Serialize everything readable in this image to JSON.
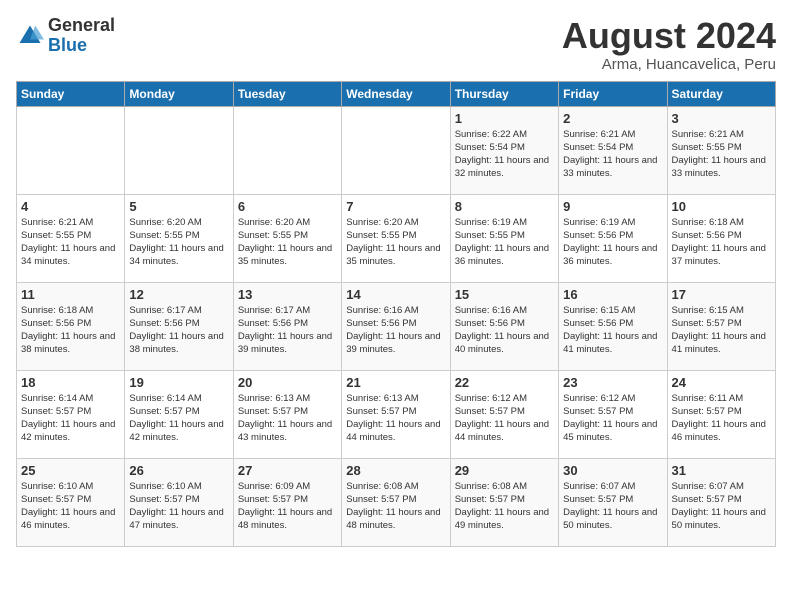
{
  "logo": {
    "general": "General",
    "blue": "Blue"
  },
  "title": "August 2024",
  "subtitle": "Arma, Huancavelica, Peru",
  "days_header": [
    "Sunday",
    "Monday",
    "Tuesday",
    "Wednesday",
    "Thursday",
    "Friday",
    "Saturday"
  ],
  "weeks": [
    [
      {
        "day": "",
        "sunrise": "",
        "sunset": "",
        "daylight": ""
      },
      {
        "day": "",
        "sunrise": "",
        "sunset": "",
        "daylight": ""
      },
      {
        "day": "",
        "sunrise": "",
        "sunset": "",
        "daylight": ""
      },
      {
        "day": "",
        "sunrise": "",
        "sunset": "",
        "daylight": ""
      },
      {
        "day": "1",
        "sunrise": "Sunrise: 6:22 AM",
        "sunset": "Sunset: 5:54 PM",
        "daylight": "Daylight: 11 hours and 32 minutes."
      },
      {
        "day": "2",
        "sunrise": "Sunrise: 6:21 AM",
        "sunset": "Sunset: 5:54 PM",
        "daylight": "Daylight: 11 hours and 33 minutes."
      },
      {
        "day": "3",
        "sunrise": "Sunrise: 6:21 AM",
        "sunset": "Sunset: 5:55 PM",
        "daylight": "Daylight: 11 hours and 33 minutes."
      }
    ],
    [
      {
        "day": "4",
        "sunrise": "Sunrise: 6:21 AM",
        "sunset": "Sunset: 5:55 PM",
        "daylight": "Daylight: 11 hours and 34 minutes."
      },
      {
        "day": "5",
        "sunrise": "Sunrise: 6:20 AM",
        "sunset": "Sunset: 5:55 PM",
        "daylight": "Daylight: 11 hours and 34 minutes."
      },
      {
        "day": "6",
        "sunrise": "Sunrise: 6:20 AM",
        "sunset": "Sunset: 5:55 PM",
        "daylight": "Daylight: 11 hours and 35 minutes."
      },
      {
        "day": "7",
        "sunrise": "Sunrise: 6:20 AM",
        "sunset": "Sunset: 5:55 PM",
        "daylight": "Daylight: 11 hours and 35 minutes."
      },
      {
        "day": "8",
        "sunrise": "Sunrise: 6:19 AM",
        "sunset": "Sunset: 5:55 PM",
        "daylight": "Daylight: 11 hours and 36 minutes."
      },
      {
        "day": "9",
        "sunrise": "Sunrise: 6:19 AM",
        "sunset": "Sunset: 5:56 PM",
        "daylight": "Daylight: 11 hours and 36 minutes."
      },
      {
        "day": "10",
        "sunrise": "Sunrise: 6:18 AM",
        "sunset": "Sunset: 5:56 PM",
        "daylight": "Daylight: 11 hours and 37 minutes."
      }
    ],
    [
      {
        "day": "11",
        "sunrise": "Sunrise: 6:18 AM",
        "sunset": "Sunset: 5:56 PM",
        "daylight": "Daylight: 11 hours and 38 minutes."
      },
      {
        "day": "12",
        "sunrise": "Sunrise: 6:17 AM",
        "sunset": "Sunset: 5:56 PM",
        "daylight": "Daylight: 11 hours and 38 minutes."
      },
      {
        "day": "13",
        "sunrise": "Sunrise: 6:17 AM",
        "sunset": "Sunset: 5:56 PM",
        "daylight": "Daylight: 11 hours and 39 minutes."
      },
      {
        "day": "14",
        "sunrise": "Sunrise: 6:16 AM",
        "sunset": "Sunset: 5:56 PM",
        "daylight": "Daylight: 11 hours and 39 minutes."
      },
      {
        "day": "15",
        "sunrise": "Sunrise: 6:16 AM",
        "sunset": "Sunset: 5:56 PM",
        "daylight": "Daylight: 11 hours and 40 minutes."
      },
      {
        "day": "16",
        "sunrise": "Sunrise: 6:15 AM",
        "sunset": "Sunset: 5:56 PM",
        "daylight": "Daylight: 11 hours and 41 minutes."
      },
      {
        "day": "17",
        "sunrise": "Sunrise: 6:15 AM",
        "sunset": "Sunset: 5:57 PM",
        "daylight": "Daylight: 11 hours and 41 minutes."
      }
    ],
    [
      {
        "day": "18",
        "sunrise": "Sunrise: 6:14 AM",
        "sunset": "Sunset: 5:57 PM",
        "daylight": "Daylight: 11 hours and 42 minutes."
      },
      {
        "day": "19",
        "sunrise": "Sunrise: 6:14 AM",
        "sunset": "Sunset: 5:57 PM",
        "daylight": "Daylight: 11 hours and 42 minutes."
      },
      {
        "day": "20",
        "sunrise": "Sunrise: 6:13 AM",
        "sunset": "Sunset: 5:57 PM",
        "daylight": "Daylight: 11 hours and 43 minutes."
      },
      {
        "day": "21",
        "sunrise": "Sunrise: 6:13 AM",
        "sunset": "Sunset: 5:57 PM",
        "daylight": "Daylight: 11 hours and 44 minutes."
      },
      {
        "day": "22",
        "sunrise": "Sunrise: 6:12 AM",
        "sunset": "Sunset: 5:57 PM",
        "daylight": "Daylight: 11 hours and 44 minutes."
      },
      {
        "day": "23",
        "sunrise": "Sunrise: 6:12 AM",
        "sunset": "Sunset: 5:57 PM",
        "daylight": "Daylight: 11 hours and 45 minutes."
      },
      {
        "day": "24",
        "sunrise": "Sunrise: 6:11 AM",
        "sunset": "Sunset: 5:57 PM",
        "daylight": "Daylight: 11 hours and 46 minutes."
      }
    ],
    [
      {
        "day": "25",
        "sunrise": "Sunrise: 6:10 AM",
        "sunset": "Sunset: 5:57 PM",
        "daylight": "Daylight: 11 hours and 46 minutes."
      },
      {
        "day": "26",
        "sunrise": "Sunrise: 6:10 AM",
        "sunset": "Sunset: 5:57 PM",
        "daylight": "Daylight: 11 hours and 47 minutes."
      },
      {
        "day": "27",
        "sunrise": "Sunrise: 6:09 AM",
        "sunset": "Sunset: 5:57 PM",
        "daylight": "Daylight: 11 hours and 48 minutes."
      },
      {
        "day": "28",
        "sunrise": "Sunrise: 6:08 AM",
        "sunset": "Sunset: 5:57 PM",
        "daylight": "Daylight: 11 hours and 48 minutes."
      },
      {
        "day": "29",
        "sunrise": "Sunrise: 6:08 AM",
        "sunset": "Sunset: 5:57 PM",
        "daylight": "Daylight: 11 hours and 49 minutes."
      },
      {
        "day": "30",
        "sunrise": "Sunrise: 6:07 AM",
        "sunset": "Sunset: 5:57 PM",
        "daylight": "Daylight: 11 hours and 50 minutes."
      },
      {
        "day": "31",
        "sunrise": "Sunrise: 6:07 AM",
        "sunset": "Sunset: 5:57 PM",
        "daylight": "Daylight: 11 hours and 50 minutes."
      }
    ]
  ]
}
